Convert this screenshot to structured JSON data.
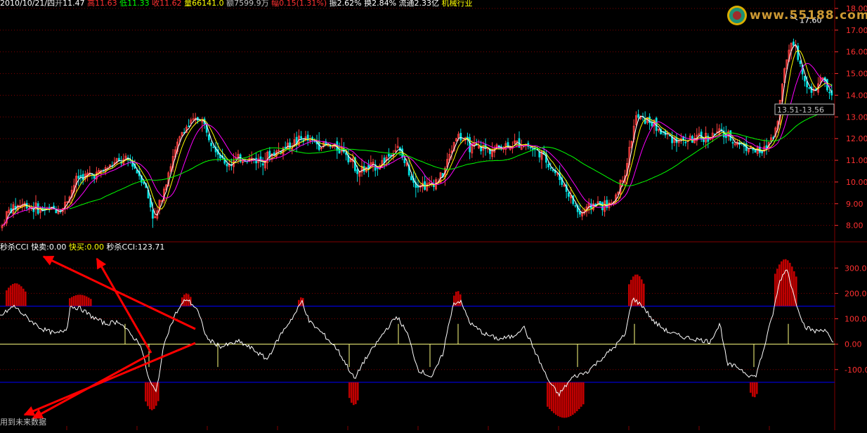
{
  "header": {
    "date": "2010/10/21/四",
    "open_label": "开",
    "open": "11.47",
    "high_label": "高",
    "high": "11.63",
    "low_label": "低",
    "low": "11.33",
    "close_label": "收",
    "close": "11.62",
    "vol_label": "量",
    "vol": "66141.0",
    "amt_label": "额",
    "amt": "7599.9万",
    "chg_label": "幅",
    "chg": "0.15(1.31%)",
    "amp_label": "振",
    "amp": "2.62%",
    "turn_label": "换",
    "turn": "2.84%",
    "float_label": "流通",
    "float": "2.33亿",
    "industry": "机械行业"
  },
  "indicator_header": {
    "name": "秒杀CCI",
    "fast_sell_label": "快卖:",
    "fast_sell": "0.00",
    "fast_buy_label": "快买:",
    "fast_buy": "0.00",
    "cci_label": "秒杀CCI:",
    "cci": "123.71"
  },
  "annotation": {
    "text": "用到未来数据"
  },
  "watermark": {
    "text": "www.55188.com"
  },
  "colors": {
    "background": "#000000",
    "up": "#ff4040",
    "down": "#00e0e0",
    "ma_fast": "#ffffff",
    "ma_mid": "#ffff00",
    "ma_slow": "#ff00ff",
    "ma_long": "#00ff00",
    "cci_line": "#ffffff",
    "cci_bar": "#c00000",
    "band": "#0000ff",
    "zero": "#ffff80",
    "grid": "#800000",
    "axis_text": "#ff3030",
    "arrow": "#ff0000"
  },
  "chart_data": [
    {
      "type": "candlestick",
      "ylim": [
        7.6,
        18.0
      ],
      "yticks": [
        "8.00",
        "9.00",
        "10.00",
        "11.00",
        "12.00",
        "13.00",
        "14.00",
        "15.00",
        "16.00",
        "17.00",
        "18.00"
      ],
      "max_label": "17.60",
      "range_label": "13.51-13.56",
      "price_path": [
        [
          0,
          7.7
        ],
        [
          10,
          8.6
        ],
        [
          30,
          9.0
        ],
        [
          60,
          8.7
        ],
        [
          90,
          8.8
        ],
        [
          110,
          10.2
        ],
        [
          140,
          10.4
        ],
        [
          165,
          10.9
        ],
        [
          185,
          11.0
        ],
        [
          205,
          10.0
        ],
        [
          220,
          8.2
        ],
        [
          240,
          10.5
        ],
        [
          260,
          12.4
        ],
        [
          285,
          13.0
        ],
        [
          300,
          12.0
        ],
        [
          320,
          10.8
        ],
        [
          345,
          11.1
        ],
        [
          370,
          11.0
        ],
        [
          400,
          11.5
        ],
        [
          430,
          12.0
        ],
        [
          460,
          11.7
        ],
        [
          490,
          11.5
        ],
        [
          510,
          10.5
        ],
        [
          540,
          10.8
        ],
        [
          565,
          11.6
        ],
        [
          590,
          10.0
        ],
        [
          610,
          9.8
        ],
        [
          630,
          10.3
        ],
        [
          650,
          12.2
        ],
        [
          670,
          11.6
        ],
        [
          700,
          11.5
        ],
        [
          720,
          11.7
        ],
        [
          745,
          11.8
        ],
        [
          770,
          11.3
        ],
        [
          800,
          10.0
        ],
        [
          825,
          8.5
        ],
        [
          845,
          9.0
        ],
        [
          870,
          8.9
        ],
        [
          890,
          10.5
        ],
        [
          905,
          13.0
        ],
        [
          925,
          12.8
        ],
        [
          945,
          12.2
        ],
        [
          970,
          11.9
        ],
        [
          1000,
          12.0
        ],
        [
          1025,
          12.3
        ],
        [
          1045,
          11.9
        ],
        [
          1065,
          11.6
        ],
        [
          1085,
          11.3
        ],
        [
          1105,
          12.5
        ],
        [
          1118,
          15.5
        ],
        [
          1128,
          16.7
        ],
        [
          1140,
          15.2
        ],
        [
          1155,
          14.0
        ],
        [
          1170,
          14.8
        ],
        [
          1185,
          13.8
        ]
      ]
    },
    {
      "type": "cci",
      "ylim": [
        -300,
        370
      ],
      "yticks": [
        "300.00",
        "200.00",
        "100.00",
        "0.00",
        "-100.00"
      ],
      "upper_band": 150,
      "lower_band": -150,
      "cci_path": [
        [
          0,
          110
        ],
        [
          20,
          150
        ],
        [
          40,
          100
        ],
        [
          60,
          60
        ],
        [
          80,
          40
        ],
        [
          95,
          60
        ],
        [
          100,
          150
        ],
        [
          115,
          140
        ],
        [
          130,
          110
        ],
        [
          150,
          80
        ],
        [
          170,
          90
        ],
        [
          185,
          40
        ],
        [
          200,
          0
        ],
        [
          212,
          -140
        ],
        [
          222,
          -190
        ],
        [
          235,
          20
        ],
        [
          250,
          120
        ],
        [
          265,
          180
        ],
        [
          280,
          140
        ],
        [
          295,
          20
        ],
        [
          315,
          -10
        ],
        [
          340,
          10
        ],
        [
          360,
          -20
        ],
        [
          380,
          -60
        ],
        [
          400,
          40
        ],
        [
          420,
          120
        ],
        [
          430,
          170
        ],
        [
          440,
          90
        ],
        [
          460,
          40
        ],
        [
          480,
          -20
        ],
        [
          495,
          -90
        ],
        [
          505,
          -140
        ],
        [
          515,
          -80
        ],
        [
          530,
          -20
        ],
        [
          550,
          60
        ],
        [
          565,
          110
        ],
        [
          580,
          40
        ],
        [
          595,
          -100
        ],
        [
          615,
          -130
        ],
        [
          630,
          -40
        ],
        [
          645,
          160
        ],
        [
          655,
          170
        ],
        [
          670,
          80
        ],
        [
          690,
          40
        ],
        [
          710,
          20
        ],
        [
          730,
          30
        ],
        [
          745,
          70
        ],
        [
          760,
          -20
        ],
        [
          780,
          -140
        ],
        [
          795,
          -200
        ],
        [
          815,
          -130
        ],
        [
          835,
          -110
        ],
        [
          855,
          -60
        ],
        [
          875,
          -10
        ],
        [
          890,
          40
        ],
        [
          900,
          180
        ],
        [
          915,
          150
        ],
        [
          930,
          90
        ],
        [
          950,
          50
        ],
        [
          970,
          30
        ],
        [
          990,
          20
        ],
        [
          1010,
          10
        ],
        [
          1025,
          80
        ],
        [
          1035,
          -80
        ],
        [
          1050,
          -90
        ],
        [
          1065,
          -120
        ],
        [
          1075,
          -130
        ],
        [
          1085,
          -40
        ],
        [
          1100,
          120
        ],
        [
          1110,
          250
        ],
        [
          1120,
          300
        ],
        [
          1130,
          190
        ],
        [
          1145,
          70
        ],
        [
          1160,
          50
        ],
        [
          1175,
          60
        ],
        [
          1185,
          0
        ]
      ],
      "positive_bars": [
        {
          "x0": 8,
          "x1": 37,
          "peak": 240
        },
        {
          "x0": 98,
          "x1": 130,
          "peak": 195
        },
        {
          "x0": 258,
          "x1": 272,
          "peak": 200
        },
        {
          "x0": 424,
          "x1": 433,
          "peak": 185
        },
        {
          "x0": 645,
          "x1": 656,
          "peak": 210
        },
        {
          "x0": 894,
          "x1": 918,
          "peak": 275
        },
        {
          "x0": 1102,
          "x1": 1134,
          "peak": 335
        }
      ],
      "negative_bars": [
        {
          "x0": 206,
          "x1": 226,
          "peak": -260
        },
        {
          "x0": 496,
          "x1": 511,
          "peak": -240
        },
        {
          "x0": 778,
          "x1": 832,
          "peak": -290
        },
        {
          "x0": 1067,
          "x1": 1078,
          "peak": -210
        }
      ]
    }
  ]
}
